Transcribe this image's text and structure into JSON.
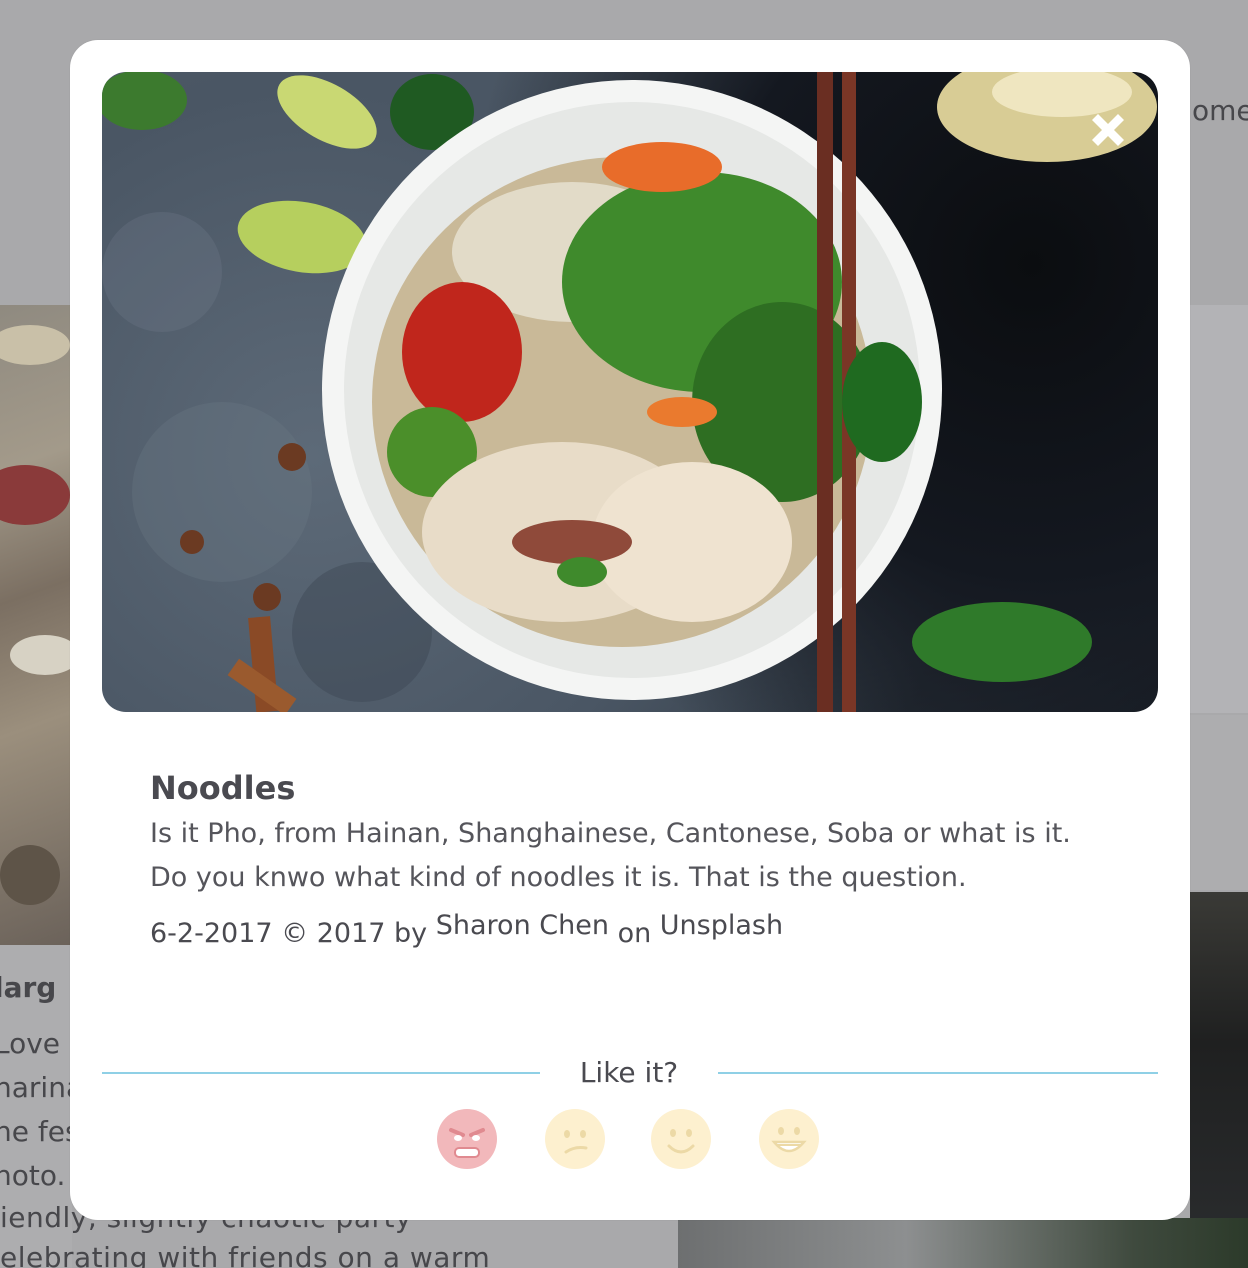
{
  "background": {
    "right_fragment": "ome",
    "left_fragment": "larg",
    "left_lines": [
      "Love",
      "narina",
      "he fes",
      "hoto."
    ],
    "bottom_lines": [
      "iendly, slightly chaotic party",
      "elebrating with friends on a warm"
    ]
  },
  "modal": {
    "photo_icon": "noodle-bowl-photo",
    "close_icon": "close-icon",
    "title": "Noodles",
    "description": "Is it Pho, from Hainan, Shanghainese, Cantonese, Soba or what is it. Do you knwo what kind of noodles it is. That is the question.",
    "credit": {
      "date": "6-2-2017",
      "copyright": "© 2017 by",
      "author": "Sharon Chen",
      "on": "on",
      "source": "Unsplash"
    },
    "rating": {
      "label": "Like it?",
      "options": [
        {
          "name": "angry",
          "icon": "angry-face-icon",
          "color": "#f2b8bb"
        },
        {
          "name": "confused",
          "icon": "confused-face-icon",
          "color": "#fdf0cf"
        },
        {
          "name": "smile",
          "icon": "smile-face-icon",
          "color": "#fdf0cf"
        },
        {
          "name": "grin",
          "icon": "grin-face-icon",
          "color": "#fdf0cf"
        }
      ]
    }
  },
  "colors": {
    "overlay": "#a9a9ab",
    "divider": "#8fd0e6",
    "text": "#4a4a50"
  }
}
